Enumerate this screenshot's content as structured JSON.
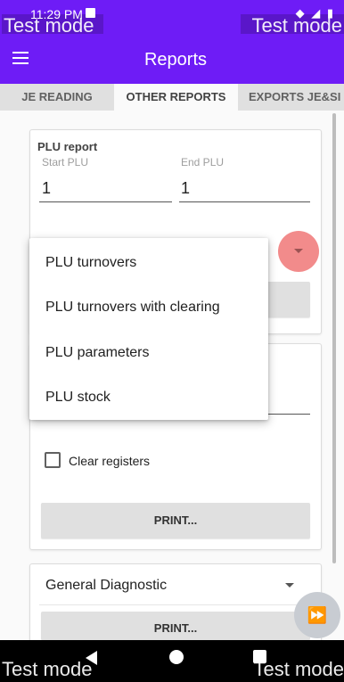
{
  "status_bar": {
    "time": "11:29 PM",
    "watermark_left": "Test mode",
    "watermark_right": "Test mode",
    "icons": "◆ ◢ ▮"
  },
  "app_bar": {
    "title": "Reports"
  },
  "tabs": [
    {
      "label": "JE READING",
      "active": false
    },
    {
      "label": "OTHER REPORTS",
      "active": true
    },
    {
      "label": "EXPORTS JE&SI",
      "active": false
    }
  ],
  "plu_card": {
    "title": "PLU report",
    "start_caption": "Start PLU",
    "start_value": "1",
    "end_caption": "End PLU",
    "end_value": "1"
  },
  "dropdown_menu": {
    "items": [
      "PLU turnovers",
      "PLU turnovers with clearing",
      "PLU parameters",
      "PLU stock"
    ]
  },
  "second_card": {
    "clear_registers_label": "Clear registers",
    "print_label": "PRINT..."
  },
  "diagnostic_card": {
    "selected": "General Diagnostic",
    "print_label": "PRINT..."
  },
  "nav_bar": {
    "watermark_left": "Test mode",
    "watermark_right": "Test mode"
  },
  "colors": {
    "primary": "#6e1cf6",
    "dropdown_indicator": "#f28b8b",
    "button_bg": "#e0e0e0"
  }
}
